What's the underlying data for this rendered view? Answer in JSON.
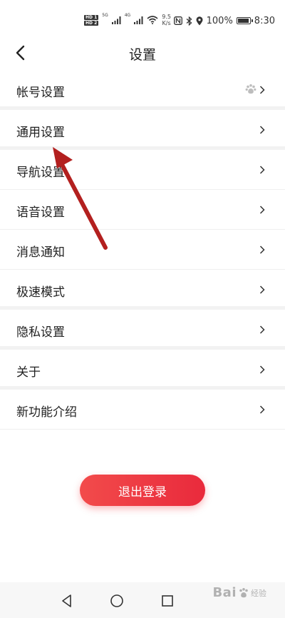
{
  "status_bar": {
    "hd1": "HD 1",
    "hd2": "HD 2",
    "sig1": "5G",
    "sig2": "4G",
    "speed_value": "9.5",
    "speed_unit": "K/s",
    "battery_text": "100%",
    "time": "8:30"
  },
  "header": {
    "title": "设置"
  },
  "menu": {
    "items": [
      {
        "label": "帐号设置"
      },
      {
        "label": "通用设置"
      },
      {
        "label": "导航设置"
      },
      {
        "label": "语音设置"
      },
      {
        "label": "消息通知"
      },
      {
        "label": "极速模式"
      },
      {
        "label": "隐私设置"
      },
      {
        "label": "关于"
      },
      {
        "label": "新功能介绍"
      }
    ]
  },
  "logout": {
    "label": "退出登录"
  },
  "watermark": {
    "text": "Bai",
    "sub": "经验"
  },
  "colors": {
    "accent": "#ee3a42",
    "annotation_arrow": "#b3201f"
  }
}
